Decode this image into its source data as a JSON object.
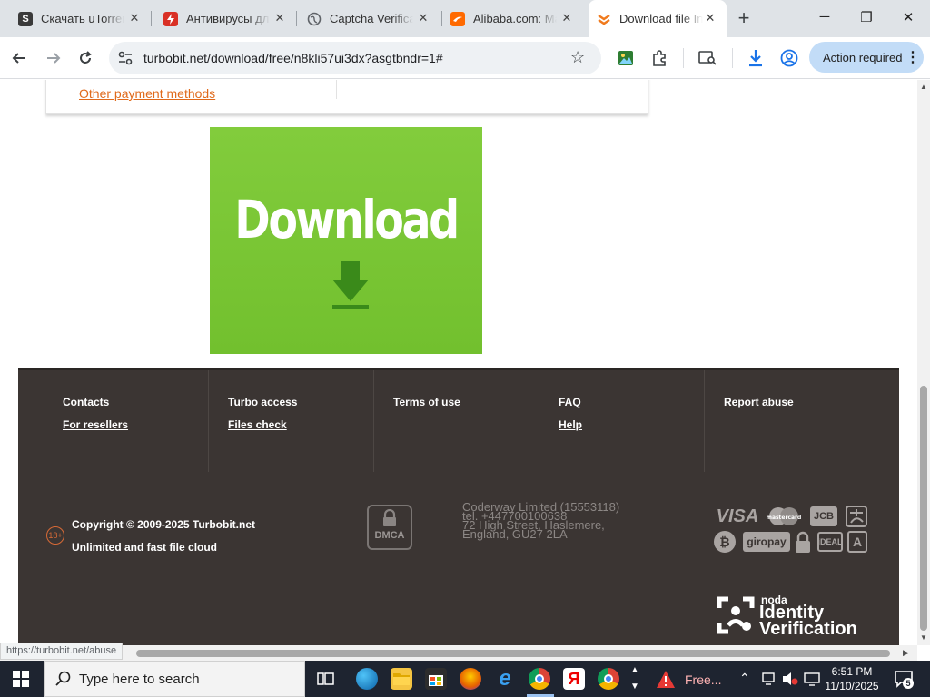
{
  "tabs": [
    {
      "title": "Скачать uTorrent",
      "favicon": "s-site-favicon",
      "favicon_letter": "S",
      "favicon_color": "#3a3a3a",
      "active": false
    },
    {
      "title": "Антивирусы для",
      "favicon": "antivirus-favicon",
      "favicon_letter": "4",
      "favicon_color": "#d93025",
      "active": false
    },
    {
      "title": "Captcha Verification",
      "favicon": "globe-favicon",
      "favicon_letter": "",
      "favicon_color": "#5f6368",
      "active": false
    },
    {
      "title": "Alibaba.com: Ma",
      "favicon": "alibaba-favicon",
      "favicon_letter": "",
      "favicon_color": "#ff6a00",
      "active": false
    },
    {
      "title": "Download file In",
      "favicon": "turbobit-favicon",
      "favicon_letter": "",
      "favicon_color": "#f07a1d",
      "active": true
    }
  ],
  "toolbar": {
    "url": "turbobit.net/download/free/n8kli57ui3dx?asgtbndr=1#",
    "action_label": "Action required"
  },
  "page": {
    "payment_link": "Other payment methods",
    "download_label": "Download"
  },
  "footer": {
    "links": [
      [
        "Contacts",
        "For resellers"
      ],
      [
        "Turbo access",
        "Files check"
      ],
      [
        "Terms of use"
      ],
      [
        "FAQ",
        "Help"
      ],
      [
        "Report abuse"
      ]
    ],
    "age_badge": "18+",
    "copyright": "Copyright © 2009-2025 Turbobit.net",
    "tagline": "Unlimited and fast file cloud",
    "dmca": "DMCA",
    "address_lines": [
      "Coderway Limited (15553118)",
      "tel. +447700100638",
      "72 High Street, Haslemere,",
      "England, GU27 2LA"
    ],
    "payments": {
      "visa": "VISA",
      "mastercard": "mastercard",
      "jcb": "JCB",
      "giropay": "giropay",
      "ideal": "iDEAL"
    },
    "noda_brand": "noda",
    "noda_line1": "Identity",
    "noda_line2": "Verification"
  },
  "status_url": "https://turbobit.net/abuse",
  "taskbar": {
    "search_placeholder": "Type here to search",
    "tray_app_label": "Free...",
    "time": "6:51 PM",
    "date": "11/10/2025",
    "notification_count": "5"
  },
  "colors": {
    "footer_bg": "#3b3533",
    "download_green": "#78c434",
    "link_orange": "#e06a1b",
    "action_pill": "#c2dcf7"
  }
}
